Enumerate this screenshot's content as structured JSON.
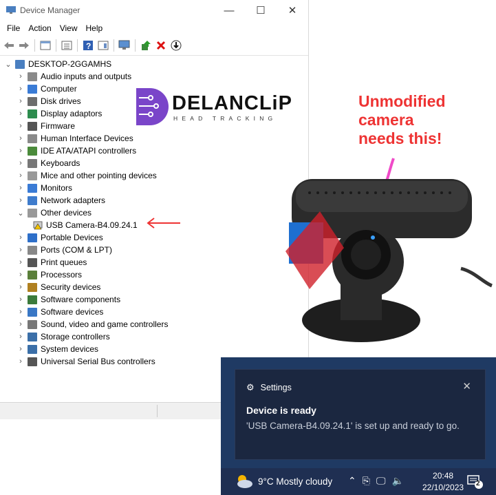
{
  "window": {
    "title": "Device Manager",
    "min": "—",
    "max": "☐",
    "close": "✕"
  },
  "menu": [
    "File",
    "Action",
    "View",
    "Help"
  ],
  "tree": {
    "root": "DESKTOP-2GGAMHS",
    "items": [
      {
        "label": "Audio inputs and outputs",
        "icon": "speaker-icon"
      },
      {
        "label": "Computer",
        "icon": "monitor-icon"
      },
      {
        "label": "Disk drives",
        "icon": "disk-drive-icon"
      },
      {
        "label": "Display adaptors",
        "icon": "display-adapter-icon"
      },
      {
        "label": "Firmware",
        "icon": "firmware-icon"
      },
      {
        "label": "Human Interface Devices",
        "icon": "hid-icon"
      },
      {
        "label": "IDE ATA/ATAPI controllers",
        "icon": "ide-controller-icon"
      },
      {
        "label": "Keyboards",
        "icon": "keyboard-icon"
      },
      {
        "label": "Mice and other pointing devices",
        "icon": "mouse-icon"
      },
      {
        "label": "Monitors",
        "icon": "monitor-icon"
      },
      {
        "label": "Network adapters",
        "icon": "network-adapter-icon"
      },
      {
        "label": "Other devices",
        "icon": "unknown-device-icon",
        "expanded": true
      },
      {
        "label": "USB Camera-B4.09.24.1",
        "icon": "warning-device-icon",
        "child": true
      },
      {
        "label": "Portable Devices",
        "icon": "portable-device-icon"
      },
      {
        "label": "Ports (COM & LPT)",
        "icon": "port-icon"
      },
      {
        "label": "Print queues",
        "icon": "printer-icon"
      },
      {
        "label": "Processors",
        "icon": "processor-icon"
      },
      {
        "label": "Security devices",
        "icon": "security-device-icon"
      },
      {
        "label": "Software components",
        "icon": "software-component-icon"
      },
      {
        "label": "Software devices",
        "icon": "software-device-icon"
      },
      {
        "label": "Sound, video and game controllers",
        "icon": "sound-icon"
      },
      {
        "label": "Storage controllers",
        "icon": "storage-controller-icon"
      },
      {
        "label": "System devices",
        "icon": "system-device-icon"
      },
      {
        "label": "Universal Serial Bus controllers",
        "icon": "usb-icon"
      }
    ]
  },
  "logo": {
    "name": "DELANCLiP",
    "tagline": "HEAD TRACKING"
  },
  "annotation": {
    "lines": [
      "Unmodified",
      "camera",
      "needs this!"
    ],
    "color": "#e8312a"
  },
  "toast": {
    "app": "Settings",
    "title": "Device is ready",
    "message": "'USB Camera-B4.09.24.1' is set up and ready to go."
  },
  "taskbar": {
    "weather": "9°C  Mostly cloudy",
    "time": "20:48",
    "date": "22/10/2023",
    "notification_count": "2"
  }
}
